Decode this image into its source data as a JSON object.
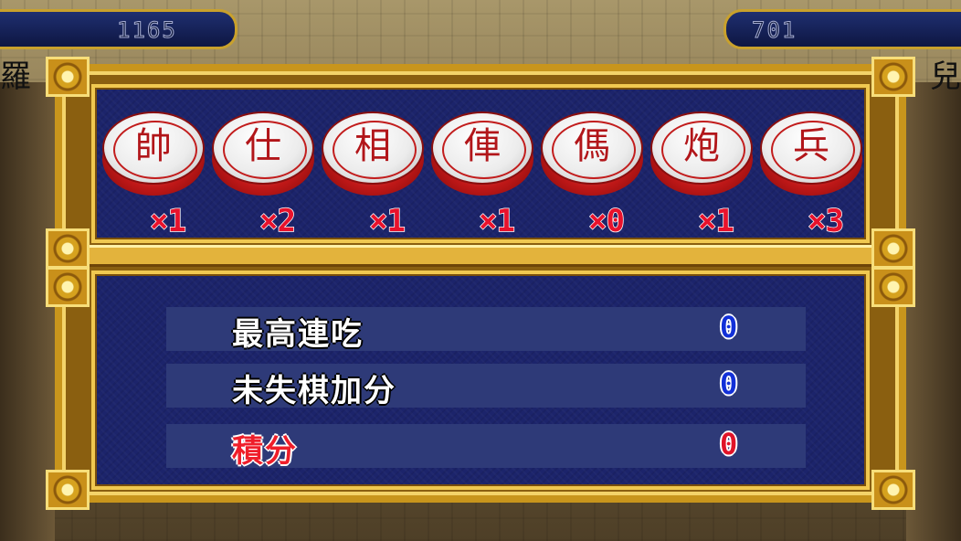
{
  "scores": {
    "left": "1165",
    "right": "701"
  },
  "names": {
    "left_partial": "羅",
    "right_partial": "兒"
  },
  "pieces": [
    {
      "char": "帥",
      "count": "×1"
    },
    {
      "char": "仕",
      "count": "×2"
    },
    {
      "char": "相",
      "count": "×1"
    },
    {
      "char": "俥",
      "count": "×1"
    },
    {
      "char": "傌",
      "count": "×0"
    },
    {
      "char": "炮",
      "count": "×1"
    },
    {
      "char": "兵",
      "count": "×3"
    }
  ],
  "stats": [
    {
      "label": "最高連吃",
      "value": "0",
      "color": "#1230d8"
    },
    {
      "label": "未失棋加分",
      "value": "0",
      "color": "#1230d8"
    },
    {
      "label": "積分",
      "value": "0",
      "color": "#e01428"
    }
  ],
  "colors": {
    "panel_bg": "#1c246b",
    "frame_gold": "#c8951c",
    "piece_text": "#b2161a",
    "count_red": "#e8122c"
  }
}
